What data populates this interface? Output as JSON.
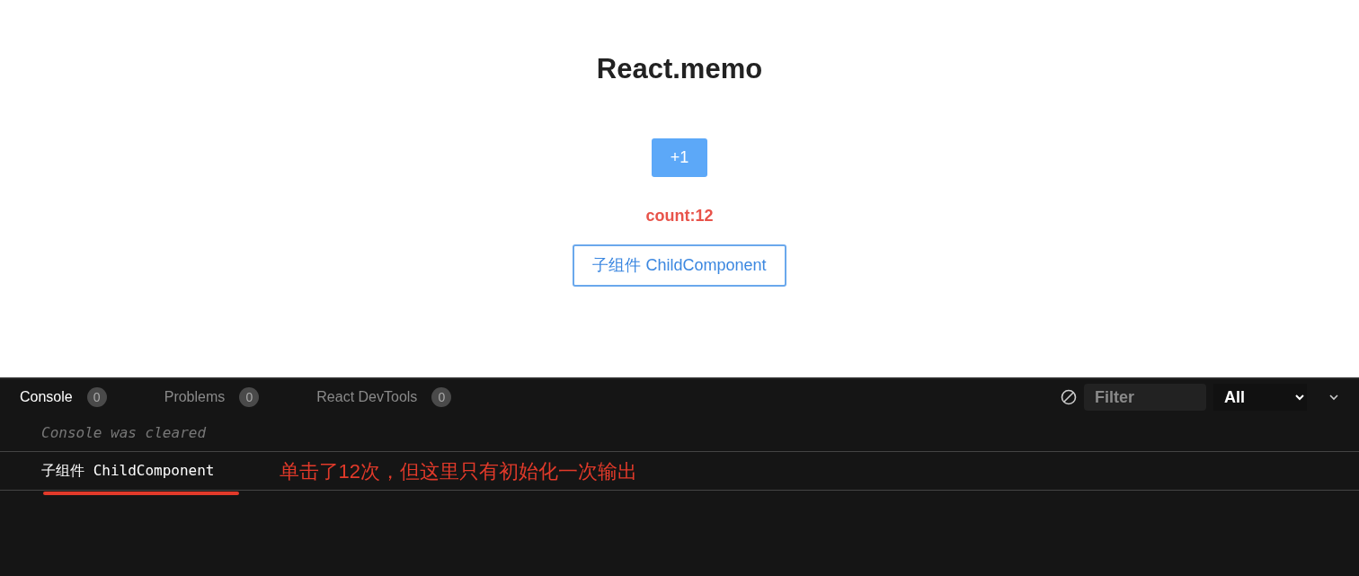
{
  "page": {
    "title": "React.memo",
    "increment_button": "+1",
    "count_text": "count:12",
    "child_component": "子组件 ChildComponent"
  },
  "console": {
    "tabs": [
      {
        "label": "Console",
        "count": "0",
        "selected": true
      },
      {
        "label": "Problems",
        "count": "0",
        "selected": false
      },
      {
        "label": "React DevTools",
        "count": "0",
        "selected": false
      }
    ],
    "filter": {
      "placeholder": "Filter"
    },
    "level_select": "All",
    "entries": [
      {
        "kind": "notice",
        "text": "Console was cleared"
      },
      {
        "kind": "log",
        "text": "子组件 ChildComponent",
        "annotation": "单击了12次，但这里只有初始化一次输出"
      }
    ]
  }
}
